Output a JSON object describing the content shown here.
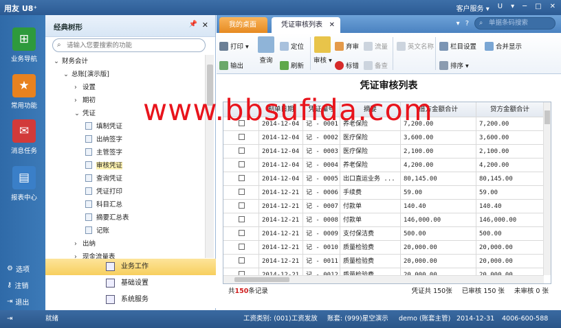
{
  "app": {
    "title": "用友 U8⁺",
    "topright": {
      "service": "客户服务 ▾",
      "u": "U",
      "minimize": "▾",
      "min2": "─",
      "max": "□",
      "close": "✕"
    }
  },
  "leftnav": {
    "items": [
      {
        "label": "业务导航",
        "icon": "tree-icon",
        "color": "#2e9a3c"
      },
      {
        "label": "常用功能",
        "icon": "star-icon",
        "color": "#e8821f"
      },
      {
        "label": "消息任务",
        "icon": "message-icon",
        "color": "#d23a3a"
      },
      {
        "label": "报表中心",
        "icon": "report-icon",
        "color": "#3a7fc8"
      }
    ],
    "bottom": [
      {
        "label": "选项",
        "icon": "gear-icon"
      },
      {
        "label": "注销",
        "icon": "key-icon"
      },
      {
        "label": "退出",
        "icon": "exit-icon"
      }
    ]
  },
  "tree": {
    "title": "经典树形",
    "search_placeholder": "请输入您要搜索的功能",
    "nodes": [
      {
        "label": "财务会计",
        "arrow": "⌄"
      },
      {
        "label": "总账[演示版]",
        "arrow": "⌄"
      },
      {
        "label": "设置",
        "arrow": "›"
      },
      {
        "label": "期初",
        "arrow": "›"
      },
      {
        "label": "凭证",
        "arrow": "⌄"
      },
      {
        "label": "填制凭证"
      },
      {
        "label": "出纳签字"
      },
      {
        "label": "主管签字"
      },
      {
        "label": "审核凭证"
      },
      {
        "label": "查询凭证"
      },
      {
        "label": "凭证打印"
      },
      {
        "label": "科目汇总"
      },
      {
        "label": "摘要汇总表"
      },
      {
        "label": "记账"
      },
      {
        "label": "出纳",
        "arrow": "›"
      },
      {
        "label": "现金流量表",
        "arrow": "›"
      }
    ],
    "groups": [
      "业务工作",
      "基础设置",
      "系统服务"
    ]
  },
  "tabs": {
    "home": "我的桌面",
    "active": "凭证审核列表",
    "search_placeholder": "单据条码搜索"
  },
  "toolbar": {
    "print": "打印",
    "export": "输出",
    "query": "查询",
    "locate": "定位",
    "refresh": "刷新",
    "audit": "审核",
    "abandon": "弃审",
    "flow": "流量",
    "mark": "标错",
    "remark": "备查",
    "en_name": "英文名称",
    "col_setting": "栏目设置",
    "sort": "排序",
    "merge": "合并显示"
  },
  "list": {
    "title": "凭证审核列表",
    "headers": [
      "",
      "制单日期",
      "凭证编号",
      "摘要",
      "借方金额合计",
      "贷方金额合计"
    ],
    "rows": [
      [
        "2014-12-04",
        "记 - 0001",
        "养老保险",
        "7,200.00",
        "7,200.00"
      ],
      [
        "2014-12-04",
        "记 - 0002",
        "医疗保险",
        "3,600.00",
        "3,600.00"
      ],
      [
        "2014-12-04",
        "记 - 0003",
        "医疗保险",
        "2,100.00",
        "2,100.00"
      ],
      [
        "2014-12-04",
        "记 - 0004",
        "养老保险",
        "4,200.00",
        "4,200.00"
      ],
      [
        "2014-12-04",
        "记 - 0005",
        "出口直运业务 ...",
        "80,145.00",
        "80,145.00"
      ],
      [
        "2014-12-21",
        "记 - 0006",
        "手续费",
        "59.00",
        "59.00"
      ],
      [
        "2014-12-21",
        "记 - 0007",
        "付款单",
        "140.40",
        "140.40"
      ],
      [
        "2014-12-21",
        "记 - 0008",
        "付款单",
        "146,000.00",
        "146,000.00"
      ],
      [
        "2014-12-21",
        "记 - 0009",
        "支付保洁费",
        "500.00",
        "500.00"
      ],
      [
        "2014-12-21",
        "记 - 0010",
        "质量检验费",
        "20,000.00",
        "20,000.00"
      ],
      [
        "2014-12-21",
        "记 - 0011",
        "质量检验费",
        "20,000.00",
        "20,000.00"
      ],
      [
        "2014-12-21",
        "记 - 0012",
        "质量检验费",
        "20,000.00",
        "20,000.00"
      ]
    ],
    "footer": {
      "total_prefix": "共",
      "total_count": "150",
      "total_suffix": "条记录",
      "vouchers": "凭证共 150张",
      "audited": "已审核 150 张",
      "unaudited": "未审核 0 张"
    }
  },
  "status": {
    "ready": "就绪",
    "salary": "工资类别: (001)工资发放",
    "account": "账套: (999)星空演示",
    "user": "demo (账套主管)",
    "date": "2014-12-31",
    "phone": "4006-600-588"
  },
  "watermark": "www.bbsufida.com"
}
